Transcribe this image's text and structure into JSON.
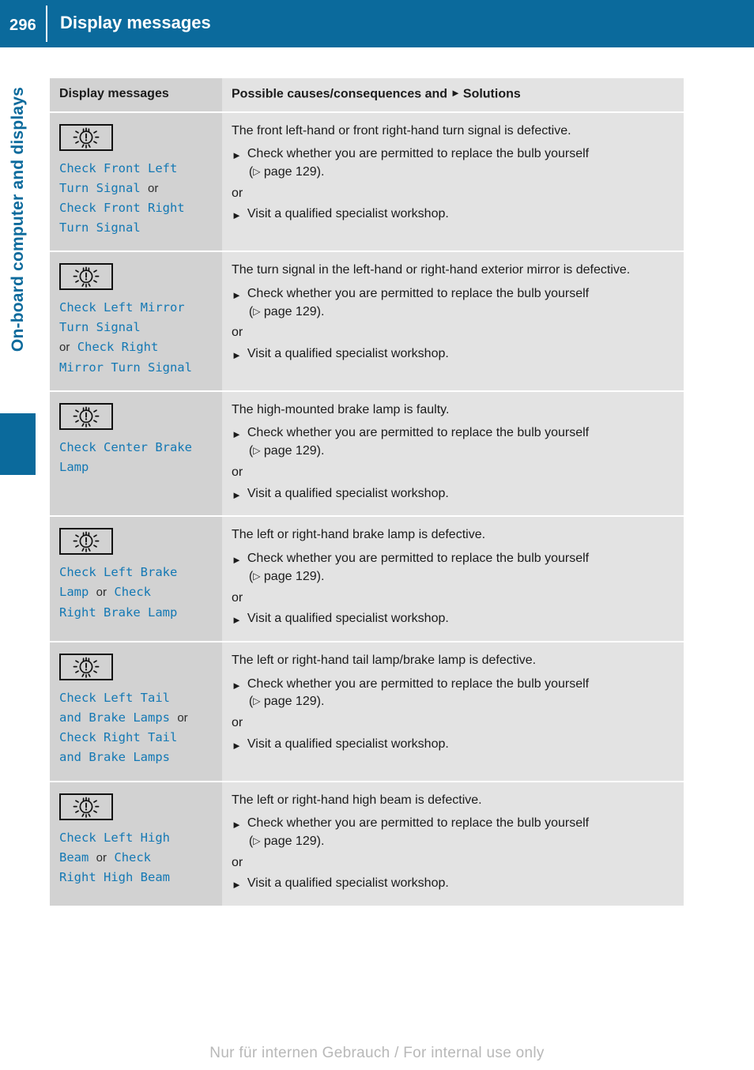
{
  "header": {
    "page_number": "296",
    "title": "Display messages"
  },
  "sidebar": {
    "chapter_label": "On-board computer and displays"
  },
  "table": {
    "columns": {
      "left_header": "Display messages",
      "right_header_before": "Possible causes/consequences and",
      "right_header_after": "Solutions"
    },
    "rows": [
      {
        "icon": "bulb-warning-icon",
        "message_parts": [
          {
            "text": "Check Front Left",
            "style": "code"
          },
          {
            "text": "Turn Signal",
            "style": "code"
          },
          {
            "text": "or",
            "style": "plain"
          },
          {
            "text": "Check Front Right",
            "style": "code"
          },
          {
            "text": "Turn Signal",
            "style": "code"
          }
        ],
        "message_lines": [
          [
            {
              "text": "Check Front Left",
              "style": "code"
            }
          ],
          [
            {
              "text": "Turn Signal",
              "style": "code"
            },
            {
              "text": "or",
              "style": "plain"
            }
          ],
          [
            {
              "text": " Check Front Right",
              "style": "code"
            }
          ],
          [
            {
              "text": "Turn Signal",
              "style": "code"
            }
          ]
        ],
        "cause": "The front left-hand or front right-hand turn signal is defective.",
        "solution_1": "Check whether you are permitted to replace the bulb yourself",
        "solution_1_ref": "page 129).",
        "or_label": "or",
        "solution_2": "Visit a qualified specialist workshop."
      },
      {
        "icon": "bulb-warning-icon",
        "message_lines": [
          [
            {
              "text": "Check Left Mirror",
              "style": "code"
            }
          ],
          [
            {
              "text": "Turn Signal",
              "style": "code"
            }
          ],
          [
            {
              "text": "or",
              "style": "plain"
            },
            {
              "text": " Check Right",
              "style": "code"
            }
          ],
          [
            {
              "text": "Mirror Turn Signal",
              "style": "code"
            }
          ]
        ],
        "cause": "The turn signal in the left-hand or right-hand exterior mirror is defective.",
        "solution_1": "Check whether you are permitted to replace the bulb yourself",
        "solution_1_ref": "page 129).",
        "or_label": "or",
        "solution_2": "Visit a qualified specialist workshop."
      },
      {
        "icon": "bulb-warning-icon",
        "message_lines": [
          [
            {
              "text": "Check Center Brake",
              "style": "code"
            }
          ],
          [
            {
              "text": "Lamp",
              "style": "code"
            }
          ]
        ],
        "cause": "The high-mounted brake lamp is faulty.",
        "solution_1": "Check whether you are permitted to replace the bulb yourself",
        "solution_1_ref": "page 129).",
        "or_label": "or",
        "solution_2": "Visit a qualified specialist workshop."
      },
      {
        "icon": "bulb-warning-icon",
        "message_lines": [
          [
            {
              "text": "Check Left Brake",
              "style": "code"
            }
          ],
          [
            {
              "text": "Lamp",
              "style": "code"
            },
            {
              "text": "or",
              "style": "plain"
            },
            {
              "text": "Check",
              "style": "code"
            }
          ],
          [
            {
              "text": "Right Brake Lamp",
              "style": "code"
            }
          ]
        ],
        "cause": "The left or right-hand brake lamp is defective.",
        "solution_1": "Check whether you are permitted to replace the bulb yourself",
        "solution_1_ref": "page 129).",
        "or_label": "or",
        "solution_2": "Visit a qualified specialist workshop."
      },
      {
        "icon": "bulb-warning-icon",
        "message_lines": [
          [
            {
              "text": "Check Left Tail",
              "style": "code"
            }
          ],
          [
            {
              "text": "and Brake Lamps",
              "style": "code"
            },
            {
              "text": "or",
              "style": "plain"
            }
          ],
          [
            {
              "text": "Check Right Tail",
              "style": "code"
            }
          ],
          [
            {
              "text": "and Brake Lamps",
              "style": "code"
            }
          ]
        ],
        "cause": "The left or right-hand tail lamp/brake lamp is defective.",
        "solution_1": "Check whether you are permitted to replace the bulb yourself",
        "solution_1_ref": "page 129).",
        "or_label": "or",
        "solution_2": "Visit a qualified specialist workshop."
      },
      {
        "icon": "bulb-warning-icon",
        "message_lines": [
          [
            {
              "text": "Check Left High",
              "style": "code"
            }
          ],
          [
            {
              "text": "Beam",
              "style": "code"
            },
            {
              "text": "or",
              "style": "plain"
            },
            {
              "text": "Check",
              "style": "code"
            }
          ],
          [
            {
              "text": "Right High Beam",
              "style": "code"
            }
          ]
        ],
        "cause": "The left or right-hand high beam is defective.",
        "solution_1": "Check whether you are permitted to replace the bulb yourself",
        "solution_1_ref": "page 129).",
        "or_label": "or",
        "solution_2": "Visit a qualified specialist workshop."
      }
    ]
  },
  "footer": {
    "note": "Nur für internen Gebrauch / For internal use only"
  },
  "colors": {
    "brand_blue": "#0b6a9c",
    "message_blue": "#1378b4",
    "header_cell_left": "#d2d2d2",
    "header_cell_right": "#e3e3e3"
  }
}
